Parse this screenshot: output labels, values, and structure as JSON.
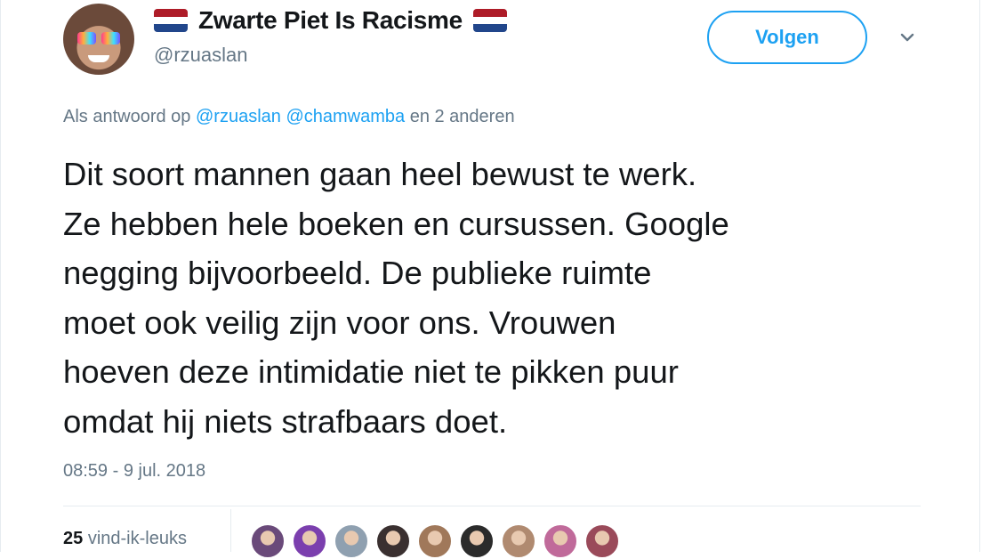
{
  "author": {
    "display_name": "Zwarte Piet Is Racisme",
    "handle": "@rzuaslan",
    "flag_left_icon": "netherlands-flag-icon",
    "flag_right_icon": "netherlands-flag-icon",
    "avatar_icon": "user-avatar"
  },
  "follow": {
    "label": "Volgen"
  },
  "menu": {
    "icon": "chevron-down-icon"
  },
  "reply_to": {
    "prefix": "Als antwoord op",
    "mention_1": "@rzuaslan",
    "mention_2": "@chamwamba",
    "suffix": "en 2 anderen"
  },
  "tweet": {
    "lines": [
      "Dit soort mannen gaan heel bewust te werk.",
      "Ze hebben hele boeken en cursussen. Google",
      "negging bijvoorbeeld. De publieke ruimte",
      "moet ook veilig zijn voor ons. Vrouwen",
      "hoeven deze intimidatie niet te pikken puur",
      "omdat hij niets strafbaars doet."
    ]
  },
  "timestamp": "08:59 - 9 jul. 2018",
  "likes": {
    "count": "25",
    "label": "vind-ik-leuks"
  },
  "likers": [
    {
      "color": "#6a4a7a"
    },
    {
      "color": "#7b3fae"
    },
    {
      "color": "#8fa0b0"
    },
    {
      "color": "#3a3030"
    },
    {
      "color": "#a0785a"
    },
    {
      "color": "#2b2b2b"
    },
    {
      "color": "#b08a70"
    },
    {
      "color": "#c06a9a"
    },
    {
      "color": "#9a4a5a"
    }
  ],
  "colors": {
    "accent": "#1da1f2",
    "text_primary": "#14171a",
    "text_secondary": "#657786",
    "flag_red": "#ae1c28",
    "flag_blue": "#21468b"
  }
}
